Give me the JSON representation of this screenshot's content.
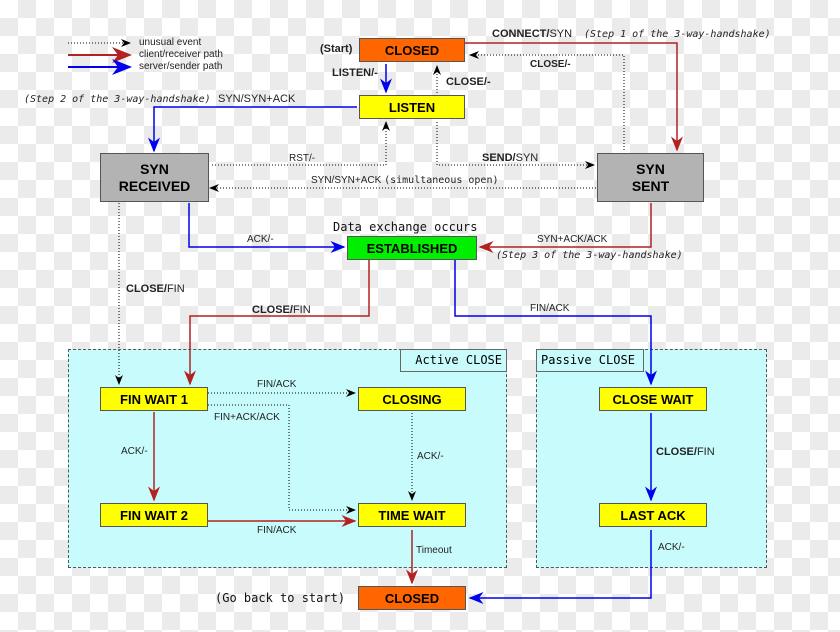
{
  "legend": {
    "items": [
      {
        "label": "unusual event",
        "style": "dotted",
        "color": "#000000"
      },
      {
        "label": "client/receiver path",
        "style": "solid",
        "color": "#b22222"
      },
      {
        "label": "server/sender path",
        "style": "solid",
        "color": "#0000ee"
      }
    ]
  },
  "colors": {
    "client": "#b22222",
    "server": "#0000ee",
    "unusual": "#000000",
    "closed": "#ff6600",
    "state": "#ffff00",
    "syn": "#b3b3b3",
    "established": "#00ee00",
    "zone": "#c8fcfc"
  },
  "states": {
    "closed_top": "CLOSED",
    "listen": "LISTEN",
    "syn_received": [
      "SYN",
      "RECEIVED"
    ],
    "syn_sent": [
      "SYN",
      "SENT"
    ],
    "established": "ESTABLISHED",
    "fin_wait_1": "FIN WAIT 1",
    "closing": "CLOSING",
    "fin_wait_2": "FIN WAIT 2",
    "time_wait": "TIME WAIT",
    "close_wait": "CLOSE WAIT",
    "last_ack": "LAST ACK",
    "closed_bottom": "CLOSED"
  },
  "zones": {
    "active": "Active CLOSE",
    "passive": "Passive CLOSE"
  },
  "annotations": {
    "start": "(Start)",
    "step1": "(Step 1 of the 3-way-handshake)",
    "step2": "(Step 2 of the 3-way-handshake)",
    "step3": "(Step 3 of the 3-way-handshake)",
    "data_exchange": "Data exchange occurs",
    "go_back": "(Go back to start)"
  },
  "transitions": {
    "connect_event": "CONNECT/",
    "connect_action": "SYN",
    "listen": "LISTEN/-",
    "close_listen": "CLOSE/-",
    "close_synsent": "CLOSE/-",
    "synrcv_from_listen": "SYN/SYN+ACK",
    "rst": "RST/-",
    "send_event": "SEND/",
    "send_action": "SYN",
    "simultaneous": "SYN/SYN+ACK",
    "simultaneous_note": "(simultaneous open)",
    "ack_est": "ACK/-",
    "synack": "SYN+ACK/ACK",
    "close_fin_event": "CLOSE/",
    "close_fin_action": "FIN",
    "close_fin2_event": "CLOSE/",
    "close_fin2_action": "FIN",
    "fin_ack_passive": "FIN/ACK",
    "fin_ack_closing": "FIN/ACK",
    "finack_ack": "FIN+ACK/ACK",
    "ack_fw2": "ACK/-",
    "ack_tw": "ACK/-",
    "fin_ack_tw": "FIN/ACK",
    "timeout": "Timeout",
    "close_fin3_event": "CLOSE/",
    "close_fin3_action": "FIN",
    "ack_lastack": "ACK/-"
  }
}
